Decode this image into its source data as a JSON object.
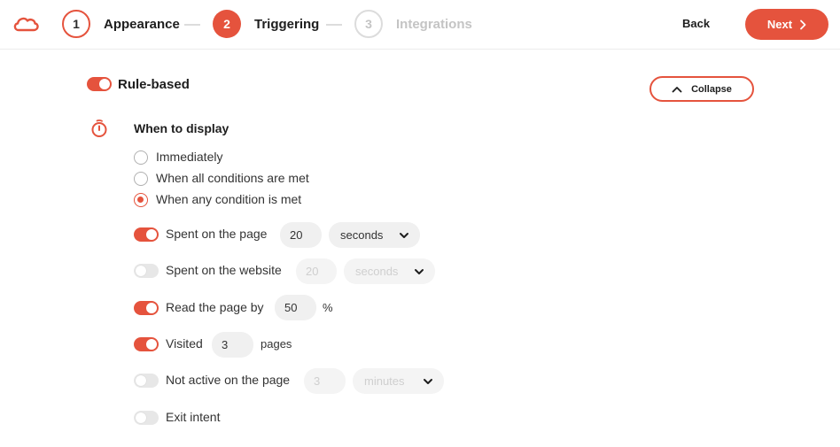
{
  "brand": {
    "accent": "#e5533d",
    "muted": "#cfcfcf"
  },
  "header": {
    "logo_icon": "cloud-logo-icon",
    "steps": [
      {
        "number": "1",
        "label": "Appearance",
        "state": "completed"
      },
      {
        "number": "2",
        "label": "Triggering",
        "state": "active"
      },
      {
        "number": "3",
        "label": "Integrations",
        "state": "pending"
      }
    ],
    "back_label": "Back",
    "next_label": "Next"
  },
  "rule": {
    "label": "Rule-based",
    "enabled": true,
    "collapse_label": "Collapse"
  },
  "display": {
    "title": "When to display",
    "icon": "stopwatch-icon",
    "options": [
      {
        "label": "Immediately",
        "checked": false
      },
      {
        "label": "When all conditions are met",
        "checked": false
      },
      {
        "label": "When any condition is met",
        "checked": true
      }
    ]
  },
  "conditions": {
    "spent_page": {
      "label": "Spent on the page",
      "enabled": true,
      "value": "20",
      "unit": "seconds"
    },
    "spent_website": {
      "label": "Spent on the website",
      "enabled": false,
      "value": "20",
      "unit": "seconds"
    },
    "read_page": {
      "label": "Read the page by",
      "enabled": true,
      "value": "50",
      "unit": "%"
    },
    "visited": {
      "label": "Visited",
      "enabled": true,
      "value": "3",
      "unit": "pages"
    },
    "not_active": {
      "label": "Not active on the page",
      "enabled": false,
      "value": "3",
      "unit": "minutes"
    },
    "exit_intent": {
      "label": "Exit intent",
      "enabled": false
    }
  }
}
